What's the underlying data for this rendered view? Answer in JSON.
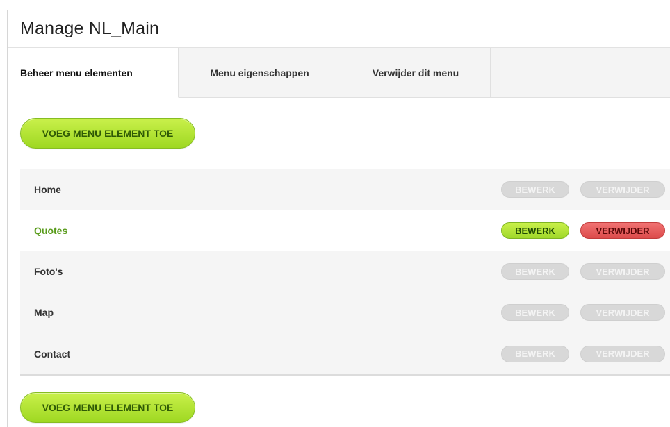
{
  "page": {
    "title": "Manage NL_Main"
  },
  "tabs": [
    {
      "label": "Beheer menu elementen",
      "active": true
    },
    {
      "label": "Menu eigenschappen",
      "active": false
    },
    {
      "label": "Verwijder dit menu",
      "active": false
    }
  ],
  "actions": {
    "add_label": "VOEG MENU ELEMENT TOE"
  },
  "row_buttons": {
    "edit_label": "BEWERK",
    "delete_label": "VERWIJDER"
  },
  "menu_items": [
    {
      "label": "Home",
      "active": false
    },
    {
      "label": "Quotes",
      "active": true
    },
    {
      "label": "Foto's",
      "active": false
    },
    {
      "label": "Map",
      "active": false
    },
    {
      "label": "Contact",
      "active": false
    }
  ],
  "colors": {
    "accent_green": "#a8dd2c",
    "active_text_green": "#5a9c1c",
    "delete_red": "#e05a5a",
    "muted_button": "#d8d8d8"
  }
}
